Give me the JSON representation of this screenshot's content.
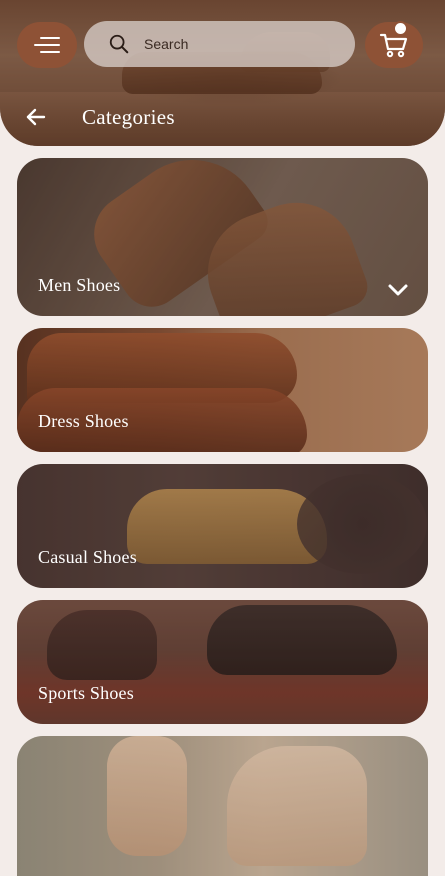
{
  "header": {
    "search_placeholder": "Search",
    "title": "Categories"
  },
  "categories": [
    {
      "label": "Men Shoes",
      "expanded_indicator": "chevron-down"
    },
    {
      "label": "Dress Shoes"
    },
    {
      "label": "Casual Shoes"
    },
    {
      "label": "Sports Shoes"
    },
    {
      "label": ""
    }
  ],
  "colors": {
    "accent": "#8e5236",
    "background": "#f3ece9",
    "search_bg": "#d7cdc8"
  }
}
